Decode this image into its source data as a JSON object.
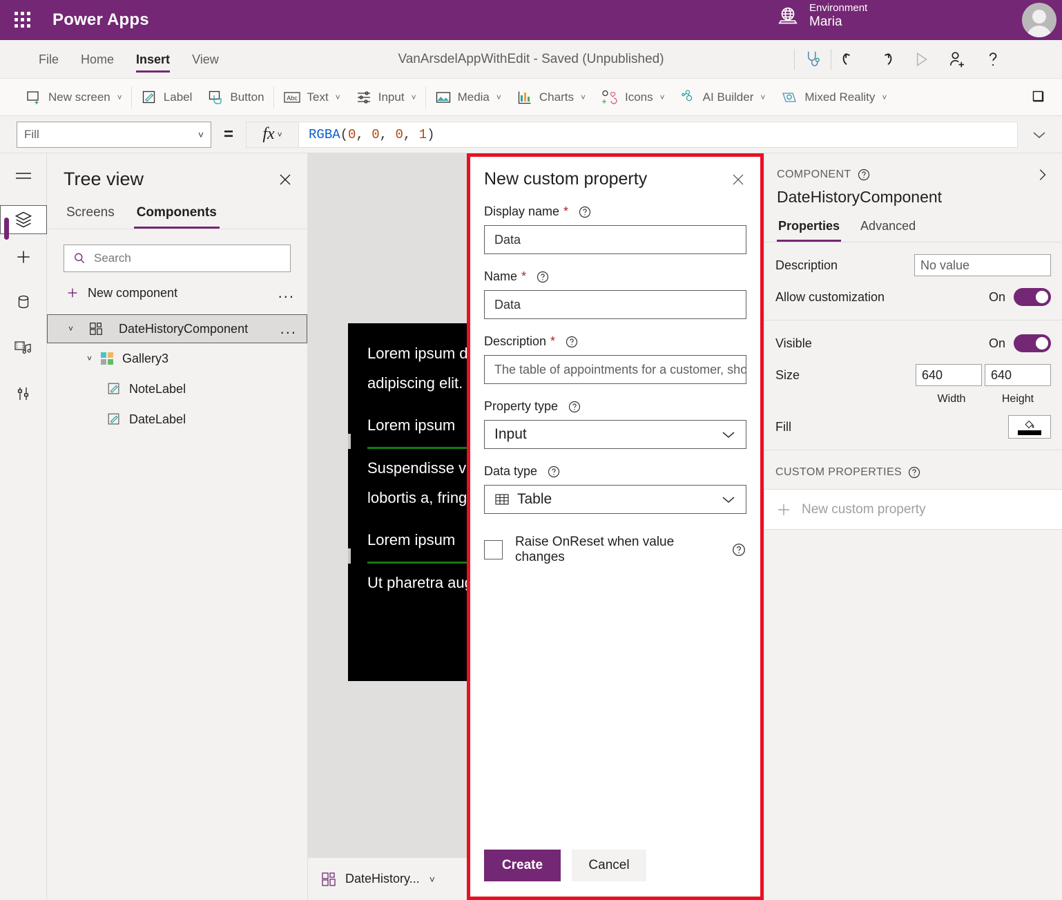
{
  "topbar": {
    "brand": "Power Apps",
    "waffle_icon": "waffle-grid-icon",
    "environment_label": "Environment",
    "environment_name": "Maria",
    "globe_icon": "globe-icon",
    "avatar_icon": "user-avatar",
    "accent_purple": "#742774"
  },
  "menubar": {
    "items": [
      {
        "label": "File",
        "active": false
      },
      {
        "label": "Home",
        "active": false
      },
      {
        "label": "Insert",
        "active": true
      },
      {
        "label": "View",
        "active": false
      }
    ],
    "app_title": "VanArsdelAppWithEdit - Saved (Unpublished)",
    "icons": [
      {
        "name": "app-checker-icon",
        "glyph": "stethoscope"
      },
      {
        "name": "undo-icon",
        "glyph": "undo"
      },
      {
        "name": "redo-icon",
        "glyph": "redo"
      },
      {
        "name": "preview-play-icon",
        "glyph": "play"
      },
      {
        "name": "share-icon",
        "glyph": "person-add"
      },
      {
        "name": "help-icon",
        "glyph": "question"
      }
    ]
  },
  "ribbon": {
    "items": [
      {
        "label": "New screen",
        "icon": "new-screen-icon",
        "caret": true
      },
      {
        "label": "Label",
        "icon": "label-icon",
        "caret": false
      },
      {
        "label": "Button",
        "icon": "button-icon",
        "caret": false
      },
      {
        "label": "Text",
        "icon": "text-abc-icon",
        "caret": true
      },
      {
        "label": "Input",
        "icon": "input-sliders-icon",
        "caret": true
      },
      {
        "label": "Media",
        "icon": "media-image-icon",
        "caret": true
      },
      {
        "label": "Charts",
        "icon": "charts-bar-icon",
        "caret": true
      },
      {
        "label": "Icons",
        "icon": "icons-shapes-icon",
        "caret": true
      },
      {
        "label": "AI Builder",
        "icon": "ai-builder-icon",
        "caret": true
      },
      {
        "label": "Mixed Reality",
        "icon": "mixed-reality-icon",
        "caret": true
      }
    ],
    "overflow_icon": "chevron-down-icon"
  },
  "formula_bar": {
    "property_selected": "Fill",
    "equals": "=",
    "fx_label": "fx",
    "formula": {
      "fn": "RGBA",
      "open": "(",
      "args": [
        "0",
        "0",
        "0",
        "1"
      ],
      "close": ")"
    },
    "expand_icon": "chevron-down-icon"
  },
  "rail": {
    "items": [
      {
        "name": "hamburger-menu-icon",
        "selected": false
      },
      {
        "name": "tree-view-layers-icon",
        "selected": true
      },
      {
        "name": "insert-plus-icon",
        "selected": false
      },
      {
        "name": "data-cylinder-icon",
        "selected": false
      },
      {
        "name": "media-icon",
        "selected": false
      },
      {
        "name": "advanced-tools-icon",
        "selected": false
      }
    ]
  },
  "tree_view": {
    "title": "Tree view",
    "close_icon": "close-icon",
    "tabs": [
      {
        "label": "Screens",
        "active": false
      },
      {
        "label": "Components",
        "active": true
      }
    ],
    "search": {
      "placeholder": "Search",
      "value": "",
      "icon": "search-icon"
    },
    "new_component": {
      "label": "New component",
      "icon": "plus-icon",
      "overflow": "..."
    },
    "nodes": [
      {
        "label": "DateHistoryComponent",
        "icon": "component-icon",
        "selected": true,
        "expanded": true,
        "overflow": "...",
        "depth": 1
      },
      {
        "label": "Gallery3",
        "icon": "gallery-icon",
        "selected": false,
        "expanded": true,
        "overflow": "",
        "depth": 2
      },
      {
        "label": "NoteLabel",
        "icon": "label-icon",
        "selected": false,
        "expanded": null,
        "overflow": "",
        "depth": 3
      },
      {
        "label": "DateLabel",
        "icon": "label-icon",
        "selected": false,
        "expanded": null,
        "overflow": "",
        "depth": 3
      }
    ]
  },
  "canvas": {
    "gallery_rows": [
      {
        "lines": [
          "Lorem ipsum dolor sit amet, consectetur",
          "adipiscing elit."
        ],
        "separator": false
      },
      {
        "lines": [
          "Lorem ipsum"
        ],
        "separator": true
      },
      {
        "lines": [
          "Suspendisse vel risus at elit mattis",
          "lobortis a, fringilla"
        ],
        "separator": false
      },
      {
        "lines": [
          "Lorem ipsum"
        ],
        "separator": true
      },
      {
        "lines": [
          "Ut pharetra augue"
        ],
        "separator": false
      }
    ],
    "gallery_background": "#000000",
    "gallery_text_color": "#ffffff",
    "separator_color": "#107c10",
    "footer": {
      "label": "DateHistory...",
      "icon": "component-icon",
      "chevron": "chevron-down-icon"
    }
  },
  "properties_panel": {
    "section_caption": "COMPONENT",
    "help_icon": "help-circle-icon",
    "collapse_icon": "chevron-right-icon",
    "component_name": "DateHistoryComponent",
    "tabs": [
      {
        "label": "Properties",
        "active": true
      },
      {
        "label": "Advanced",
        "active": false
      }
    ],
    "rows": [
      {
        "key": "Description",
        "type": "text",
        "value": "No value"
      },
      {
        "key": "Allow customization",
        "type": "toggle",
        "state": "On"
      },
      {
        "key": "Visible",
        "type": "toggle",
        "state": "On"
      },
      {
        "key": "Size",
        "type": "size",
        "width": "640",
        "height": "640",
        "width_label": "Width",
        "height_label": "Height"
      },
      {
        "key": "Fill",
        "type": "fill",
        "swatch": "#000000",
        "icon": "paint-bucket-icon"
      }
    ],
    "custom_properties": {
      "caption": "CUSTOM PROPERTIES",
      "help_icon": "help-circle-icon",
      "new_label": "New custom property",
      "new_icon": "plus-icon"
    }
  },
  "dialog": {
    "title": "New custom property",
    "close_icon": "close-icon",
    "border_color": "#e81123",
    "fields": [
      {
        "label": "Display name",
        "required": true,
        "help_icon": "help-circle-icon",
        "control": "text",
        "value": "Data",
        "name": "display-name-input"
      },
      {
        "label": "Name",
        "required": true,
        "help_icon": "help-circle-icon",
        "control": "text",
        "value": "Data",
        "name": "name-input"
      },
      {
        "label": "Description",
        "required": true,
        "help_icon": "help-circle-icon",
        "control": "text",
        "value": "The table of appointments for a customer, sho…",
        "name": "description-input"
      },
      {
        "label": "Property type",
        "required": false,
        "help_icon": "help-circle-icon",
        "control": "select",
        "value": "Input",
        "name": "property-type-select",
        "chevron": "chevron-down-icon"
      },
      {
        "label": "Data type",
        "required": false,
        "help_icon": "help-circle-icon",
        "control": "select",
        "value": "Table",
        "name": "data-type-select",
        "icon": "table-icon",
        "chevron": "chevron-down-icon"
      }
    ],
    "checkbox": {
      "label": "Raise OnReset when value changes",
      "checked": false,
      "help_icon": "help-circle-icon"
    },
    "buttons": {
      "primary": "Create",
      "secondary": "Cancel"
    }
  }
}
